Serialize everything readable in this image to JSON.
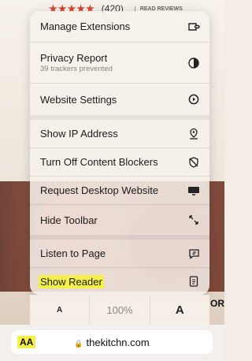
{
  "background": {
    "rating_stars": "★★★★★",
    "rating_count": "(420)",
    "read_reviews": "READ REVIEWS",
    "right_edge_text": "OR"
  },
  "menu": {
    "items": [
      {
        "label": "Manage Extensions",
        "icon": "extensions-icon"
      },
      {
        "label": "Privacy Report",
        "sublabel": "39 trackers prevented",
        "icon": "privacy-shield-icon"
      },
      {
        "label": "Website Settings",
        "icon": "settings-icon"
      },
      {
        "label": "Show IP Address",
        "icon": "location-pin-icon"
      },
      {
        "label": "Turn Off Content Blockers",
        "icon": "content-blocker-off-icon"
      },
      {
        "label": "Request Desktop Website",
        "icon": "desktop-icon"
      },
      {
        "label": "Hide Toolbar",
        "icon": "arrows-expand-icon"
      },
      {
        "label": "Listen to Page",
        "icon": "speech-bubble-icon"
      },
      {
        "label": "Show Reader",
        "icon": "reader-icon"
      }
    ]
  },
  "font_size": {
    "decrease": "A",
    "zoom": "100%",
    "increase": "A"
  },
  "address": {
    "aa_label": "AA",
    "url": "thekitchn.com"
  },
  "colors": {
    "highlight": "#f4ef4a"
  }
}
